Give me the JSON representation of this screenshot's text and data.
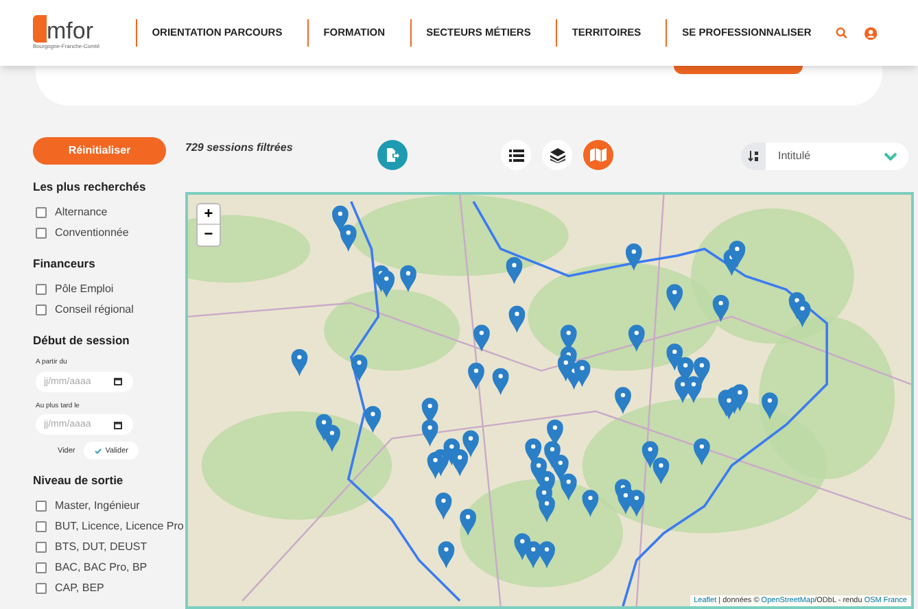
{
  "header": {
    "logo_text": "mfor",
    "logo_sub": "Bourgogne-Franche-Comté",
    "nav": [
      {
        "label": "ORIENTATION PARCOURS"
      },
      {
        "label": "FORMATION"
      },
      {
        "label": "SECTEURS MÉTIERS"
      },
      {
        "label": "TERRITOIRES"
      },
      {
        "label": "SE PROFESSIONNALISER"
      }
    ]
  },
  "sidebar": {
    "reset": "Réinitialiser",
    "groups": [
      {
        "title": "Les plus recherchés",
        "options": [
          {
            "label": "Alternance",
            "checked": false
          },
          {
            "label": "Conventionnée",
            "checked": false
          }
        ]
      },
      {
        "title": "Financeurs",
        "options": [
          {
            "label": "Pôle Emploi",
            "checked": false
          },
          {
            "label": "Conseil régional",
            "checked": false
          }
        ]
      }
    ],
    "dates": {
      "title": "Début de session",
      "fields": [
        {
          "label": "A partir du",
          "placeholder": "jj/mm/aaaa"
        },
        {
          "label": "Au plus tard le",
          "placeholder": "jj/mm/aaaa"
        }
      ],
      "clear": "Vider",
      "validate": "Valider"
    },
    "level": {
      "title": "Niveau de sortie",
      "options": [
        {
          "label": "Master, Ingénieur",
          "checked": false
        },
        {
          "label": "BUT, Licence, Licence Pro",
          "checked": false
        },
        {
          "label": "BTS, DUT, DEUST",
          "checked": false
        },
        {
          "label": "BAC, BAC Pro, BP",
          "checked": false
        },
        {
          "label": "CAP, BEP",
          "checked": false
        }
      ]
    }
  },
  "toolbar": {
    "count": "729 sessions filtrées",
    "views": [
      {
        "kind": "list",
        "selected": false
      },
      {
        "kind": "layers",
        "selected": false
      },
      {
        "kind": "map",
        "selected": true
      }
    ],
    "sort": {
      "value": "Intitulé"
    }
  },
  "map": {
    "zoom_in": "+",
    "zoom_out": "−",
    "attribution": [
      {
        "text": "Leaflet",
        "link": true
      },
      {
        "text": " | données © ",
        "link": false
      },
      {
        "text": "OpenStreetMap",
        "link": true
      },
      {
        "text": "/ODbL - rendu ",
        "link": false
      },
      {
        "text": "OSM France",
        "link": true
      }
    ]
  }
}
